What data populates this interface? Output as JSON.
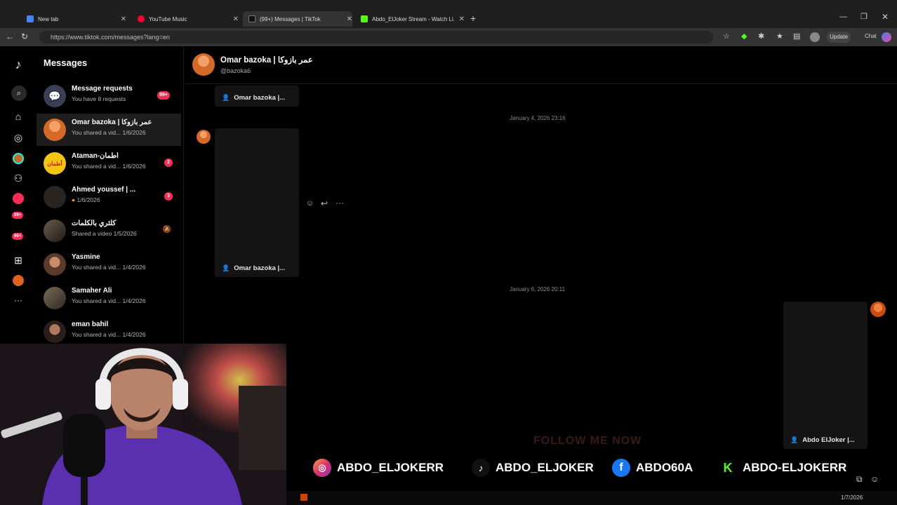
{
  "browser": {
    "tabs": [
      {
        "title": "New tab",
        "color": "#4285f4"
      },
      {
        "title": "YouTube Music",
        "color": "#ff0033"
      },
      {
        "title": "(99+) Messages | TikTok",
        "color": "#111111"
      },
      {
        "title": "Abdo_ElJoker Stream - Watch Li...",
        "color": "#53fc18"
      }
    ],
    "url": "https://www.tiktok.com/messages?lang=en",
    "update_label": "Update",
    "chat_label": "Chat"
  },
  "sidebar_badges": {
    "activity": "99+",
    "inbox": "99+"
  },
  "messages": {
    "title": "Messages",
    "conversations": [
      {
        "name": "Message requests",
        "preview": "You have 8 requests",
        "date": "",
        "badge": "99+"
      },
      {
        "name": "Omar bazoka | عمر بازوكا",
        "preview": "You shared a vid...",
        "date": "1/6/2026",
        "badge": ""
      },
      {
        "name": "Ataman-أطمان",
        "preview": "You shared a vid...",
        "date": "1/6/2026",
        "badge": "2"
      },
      {
        "name": "Ahmed youssef | ...",
        "preview": "",
        "date": "1/6/2026",
        "badge": "3"
      },
      {
        "name": "كلثري بالكلمات",
        "preview": "Shared a video",
        "date": "1/5/2026",
        "badge": ""
      },
      {
        "name": "Yasmine",
        "preview": "You shared a vid...",
        "date": "1/4/2026",
        "badge": ""
      },
      {
        "name": "Samaher Ali",
        "preview": "You shared a vid...",
        "date": "1/4/2026",
        "badge": ""
      },
      {
        "name": "eman bahil",
        "preview": "You shared a vid...",
        "date": "1/4/2026",
        "badge": ""
      }
    ]
  },
  "chat": {
    "name": "Omar bazoka | عمر بازوكا",
    "handle": "@bazoka6",
    "card1_label": "Omar bazoka |...",
    "timestamp1": "January 4, 2026 23:16",
    "card2_label": "Omar bazoka |...",
    "timestamp2": "January 6, 2026 20:11",
    "card3_label": "Abdo ElJoker |..."
  },
  "promo": {
    "title": "FOLLOW ME NOW",
    "instagram": "ABDO_ELJOKERR",
    "tiktok": "ABDO_ELJOKER",
    "facebook": "ABDO60A",
    "kick": "ABDO-ELJOKERR"
  },
  "taskbar": {
    "date": "1/7/2026"
  }
}
